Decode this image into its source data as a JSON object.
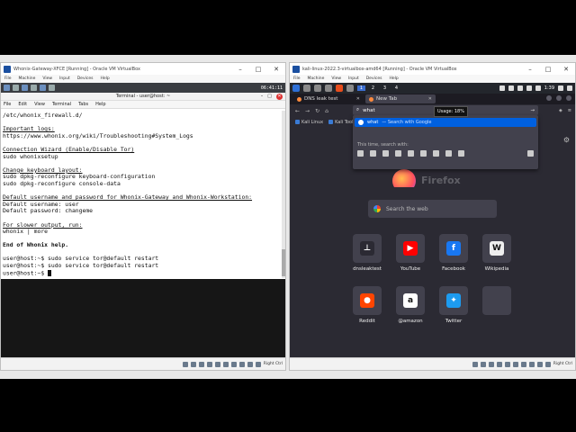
{
  "left_vm": {
    "title": "Whonix-Gateway-XFCE [Running] - Oracle VM VirtualBox",
    "menu": [
      "File",
      "Machine",
      "View",
      "Input",
      "Devices",
      "Help"
    ],
    "panel_clock": "06:41:11",
    "terminal": {
      "title": "Terminal - user@host: ~",
      "menu": [
        "File",
        "Edit",
        "View",
        "Terminal",
        "Tabs",
        "Help"
      ],
      "lines": [
        {
          "text": "/etc/whonix_firewall.d/",
          "style": ""
        },
        {
          "text": "",
          "style": "gap"
        },
        {
          "text": "Important logs:",
          "style": "u"
        },
        {
          "text": "https://www.whonix.org/wiki/Troubleshooting#System_Logs",
          "style": ""
        },
        {
          "text": "",
          "style": "gap"
        },
        {
          "text": "Connection Wizard (Enable/Disable Tor)",
          "style": "u"
        },
        {
          "text": "sudo whonixsetup",
          "style": ""
        },
        {
          "text": "",
          "style": "gap"
        },
        {
          "text": "Change keyboard layout:",
          "style": "u"
        },
        {
          "text": "sudo dpkg-reconfigure keyboard-configuration",
          "style": ""
        },
        {
          "text": "sudo dpkg-reconfigure console-data",
          "style": ""
        },
        {
          "text": "",
          "style": "gap"
        },
        {
          "text": "Default username and password for Whonix-Gateway and Whonix-Workstation:",
          "style": "u"
        },
        {
          "text": "Default username: user",
          "style": ""
        },
        {
          "text": "Default password: changeme",
          "style": ""
        },
        {
          "text": "",
          "style": "gap"
        },
        {
          "text": "For slower output, run:",
          "style": "u"
        },
        {
          "text": "whonix | more",
          "style": ""
        },
        {
          "text": "",
          "style": "gap"
        },
        {
          "text": "End of Whonix help.",
          "style": "b"
        },
        {
          "text": "",
          "style": "gap"
        },
        {
          "text": "user@host:~$ sudo service tor@default restart",
          "style": ""
        },
        {
          "text": "user@host:~$ sudo service tor@default restart",
          "style": ""
        }
      ],
      "prompt": "user@host:~$ "
    },
    "status_text": "Right Ctrl"
  },
  "right_vm": {
    "title": "kali-linux-2022.3-virtualbox-amd64 [Running] - Oracle VM VirtualBox",
    "menu": [
      "File",
      "Machine",
      "View",
      "Input",
      "Devices",
      "Help"
    ],
    "workspaces": [
      "1",
      "2",
      "3",
      "4"
    ],
    "panel_clock": "1:39",
    "firefox": {
      "tabs": [
        {
          "label": "DNS leak test",
          "active": false
        },
        {
          "label": "New Tab",
          "active": true
        }
      ],
      "tooltip": "Usage: 18%",
      "url_value": "what",
      "bookmarks": [
        "Kali Linux",
        "Kali Tools"
      ],
      "suggestion": {
        "query": "what",
        "hint": "— Search with Google"
      },
      "search_with_label": "This time, search with:",
      "logo_text": "Firefox",
      "search_placeholder": "Search the web",
      "shortcuts": [
        {
          "label": "dnsleaktest",
          "icon": "dnsleaktest-icon",
          "color": "#2b2a33",
          "glyph": "⊥"
        },
        {
          "label": "YouTube",
          "icon": "youtube-icon",
          "color": "#ff0000",
          "glyph": "▶"
        },
        {
          "label": "Facebook",
          "icon": "facebook-icon",
          "color": "#1877f2",
          "glyph": "f"
        },
        {
          "label": "Wikipedia",
          "icon": "wikipedia-icon",
          "color": "#eeeeee",
          "glyph": "W"
        },
        {
          "label": "Reddit",
          "icon": "reddit-icon",
          "color": "#ff4500",
          "glyph": "●"
        },
        {
          "label": "@amazon",
          "icon": "amazon-icon",
          "color": "#ffffff",
          "glyph": "a"
        },
        {
          "label": "Twitter",
          "icon": "twitter-icon",
          "color": "#1d9bf0",
          "glyph": "✦"
        },
        {
          "label": "",
          "icon": "empty-shortcut",
          "color": "#42414d",
          "glyph": ""
        }
      ]
    },
    "status_text": "Right Ctrl"
  }
}
